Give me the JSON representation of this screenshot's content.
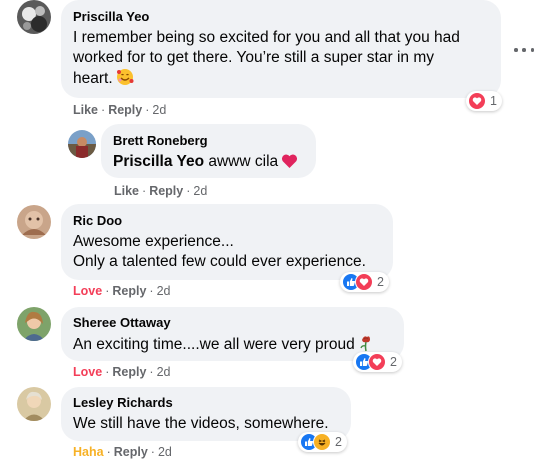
{
  "comments": [
    {
      "author": "Priscilla Yeo",
      "line1": "I remember being so excited for you and all that you had",
      "line2": "worked for to get there. You’re still a super star in my",
      "line3": "heart.",
      "emoji": "smiling-face-with-hearts-emoji",
      "action": "Like",
      "reply": "Reply",
      "time": "2d",
      "reaction_count": "1",
      "reactions": [
        "love"
      ]
    },
    {
      "author": "Brett Roneberg",
      "mention": "Priscilla Yeo",
      "text": " awww cila",
      "emoji": "red-heart-emoji",
      "action": "Like",
      "reply": "Reply",
      "time": "2d"
    },
    {
      "author": "Ric Doo",
      "line1": "Awesome experience...",
      "line2": "Only a talented few could ever experience.",
      "action": "Love",
      "reply": "Reply",
      "time": "2d",
      "reaction_count": "2",
      "reactions": [
        "like",
        "love"
      ]
    },
    {
      "author": "Sheree Ottaway",
      "text": "An exciting time....we all were very proud",
      "emoji": "wilted-flower-emoji",
      "action": "Love",
      "reply": "Reply",
      "time": "2d",
      "reaction_count": "2",
      "reactions": [
        "like",
        "love"
      ]
    },
    {
      "author": "Lesley Richards",
      "text": "We still have the videos, somewhere.",
      "action": "Haha",
      "reply": "Reply",
      "time": "2d",
      "reaction_count": "2",
      "reactions": [
        "like",
        "haha"
      ]
    }
  ],
  "separator": "·",
  "colors": {
    "bubble": "#f0f2f5",
    "meta": "#65676b",
    "like": "#1877f2",
    "love": "#f33e58",
    "haha": "#f7b125"
  }
}
